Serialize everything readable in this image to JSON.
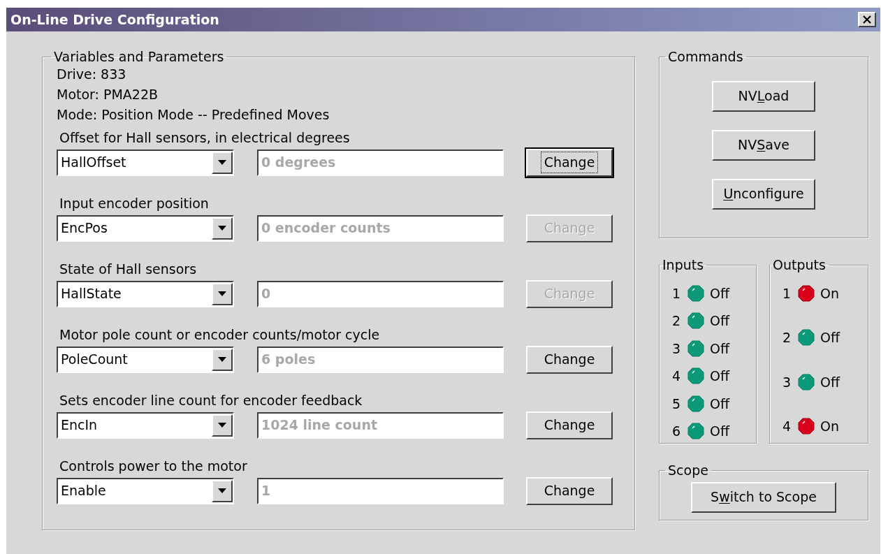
{
  "window": {
    "title": "On-Line Drive Configuration"
  },
  "parameters": {
    "title": "Variables and Parameters",
    "info": [
      "Drive: 833",
      "Motor: PMA22B",
      "Mode: Position Mode -- Predefined Moves"
    ],
    "rows": [
      {
        "description": "Offset for Hall sensors, in electrical degrees",
        "variable": "HallOffset",
        "value": "0 degrees",
        "button": "Change",
        "disabled": false,
        "focused": true
      },
      {
        "description": "Input encoder position",
        "variable": "EncPos",
        "value": "0 encoder counts",
        "button": "Change",
        "disabled": true,
        "focused": false
      },
      {
        "description": "State of Hall sensors",
        "variable": "HallState",
        "value": "0",
        "button": "Change",
        "disabled": true,
        "focused": false
      },
      {
        "description": "Motor pole count or encoder counts/motor cycle",
        "variable": "PoleCount",
        "value": "6 poles",
        "button": "Change",
        "disabled": false,
        "focused": false
      },
      {
        "description": "Sets encoder line count for encoder feedback",
        "variable": "EncIn",
        "value": "1024 line count",
        "button": "Change",
        "disabled": false,
        "focused": false
      },
      {
        "description": "Controls power to the motor",
        "variable": "Enable",
        "value": "1",
        "button": "Change",
        "disabled": false,
        "focused": false
      }
    ]
  },
  "commands": {
    "title": "Commands",
    "buttons": [
      {
        "label": {
          "before": "NV",
          "key": "L",
          "after": "oad"
        }
      },
      {
        "label": {
          "before": "NV",
          "key": "S",
          "after": "ave"
        }
      },
      {
        "label": {
          "key": "U",
          "after": "nconfigure"
        }
      }
    ]
  },
  "inputs": {
    "title": "Inputs",
    "items": [
      {
        "number": "1",
        "state": "Off",
        "on": false
      },
      {
        "number": "2",
        "state": "Off",
        "on": false
      },
      {
        "number": "3",
        "state": "Off",
        "on": false
      },
      {
        "number": "4",
        "state": "Off",
        "on": false
      },
      {
        "number": "5",
        "state": "Off",
        "on": false
      },
      {
        "number": "6",
        "state": "Off",
        "on": false
      }
    ]
  },
  "outputs": {
    "title": "Outputs",
    "items": [
      {
        "number": "1",
        "state": "On",
        "on": true
      },
      {
        "number": "2",
        "state": "Off",
        "on": false
      },
      {
        "number": "3",
        "state": "Off",
        "on": false
      },
      {
        "number": "4",
        "state": "On",
        "on": true
      }
    ]
  },
  "scope": {
    "title": "Scope",
    "button": {
      "label": {
        "before": "S",
        "key": "w",
        "after": "itch to Scope"
      }
    }
  }
}
